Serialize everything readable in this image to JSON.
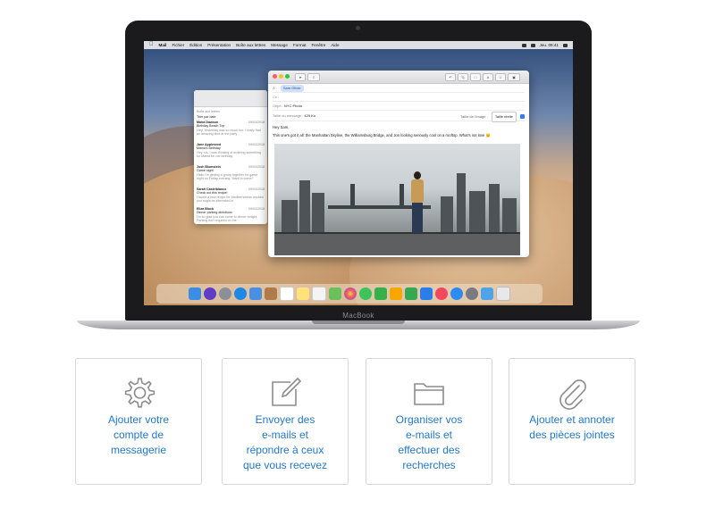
{
  "laptop": {
    "brand_label": "MacBook",
    "menubar": {
      "items": [
        "Mail",
        "Fichier",
        "Édition",
        "Présentation",
        "Boîte aux lettres",
        "Message",
        "Format",
        "Fenêtre",
        "Aide"
      ],
      "clock": "Jeu. 09:41"
    },
    "message_list": {
      "search_placeholder": "Boîte aux lettres",
      "sort_label": "Trier par date",
      "messages": [
        {
          "from": "Maira Dawson",
          "date": "09/03/2018",
          "subject": "Birthday Beach Trip",
          "preview": "Hey! Yesterday was so much fun. I really had an amazing time at the party"
        },
        {
          "from": "Jane Appleseed",
          "date": "09/03/2018",
          "subject": "Mama's Birthday",
          "preview": "Hey, sis, I was thinking of ordering something for Mama for her birthday"
        },
        {
          "from": "Josh Blumstein",
          "date": "09/03/2018",
          "subject": "Game night",
          "preview": "Hello I'm getting a group together for game night on Friday evening. Want to come?"
        },
        {
          "from": "Sarah Castelblanco",
          "date": "09/03/2018",
          "subject": "Check out this recipe!",
          "preview": "I found a new recipe for Mediterranean chicken you might be interested in"
        },
        {
          "from": "Eliza Block",
          "date": "09/03/2018",
          "subject": "Dinner parking directions",
          "preview": "I'm so glad you can come to dinner tonight. Parking isn't required on the"
        }
      ]
    },
    "compose": {
      "to_label": "À :",
      "to_recipient": "Sam Oliver",
      "cc_label": "Cc :",
      "subject_label": "Objet :",
      "subject_value": "NYC Photo",
      "message_size_label": "Taille du message :",
      "message_size_value": "429 Ko",
      "image_size_label": "Taille de l'image :",
      "image_size_value": "Taille réelle",
      "greeting": "Hey Sam,",
      "body": "This one's got it all: the Manhattan Skyline, the Williamsburg Bridge, and Jon looking seriously cool on a rooftop. What's not love 😊"
    }
  },
  "cards": [
    {
      "icon": "gear-icon",
      "lines": [
        "Ajouter votre",
        "compte de",
        "messagerie"
      ]
    },
    {
      "icon": "compose-icon",
      "lines": [
        "Envoyer des",
        "e-mails et",
        "répondre à ceux",
        "que vous recevez"
      ]
    },
    {
      "icon": "folder-icon",
      "lines": [
        "Organiser vos",
        "e-mails et",
        "effectuer des",
        "recherches"
      ]
    },
    {
      "icon": "paperclip-icon",
      "lines": [
        "Ajouter et annoter",
        "des pièces jointes"
      ]
    }
  ],
  "colors": {
    "link": "#2378c8",
    "card_border": "#d8d8d8"
  }
}
